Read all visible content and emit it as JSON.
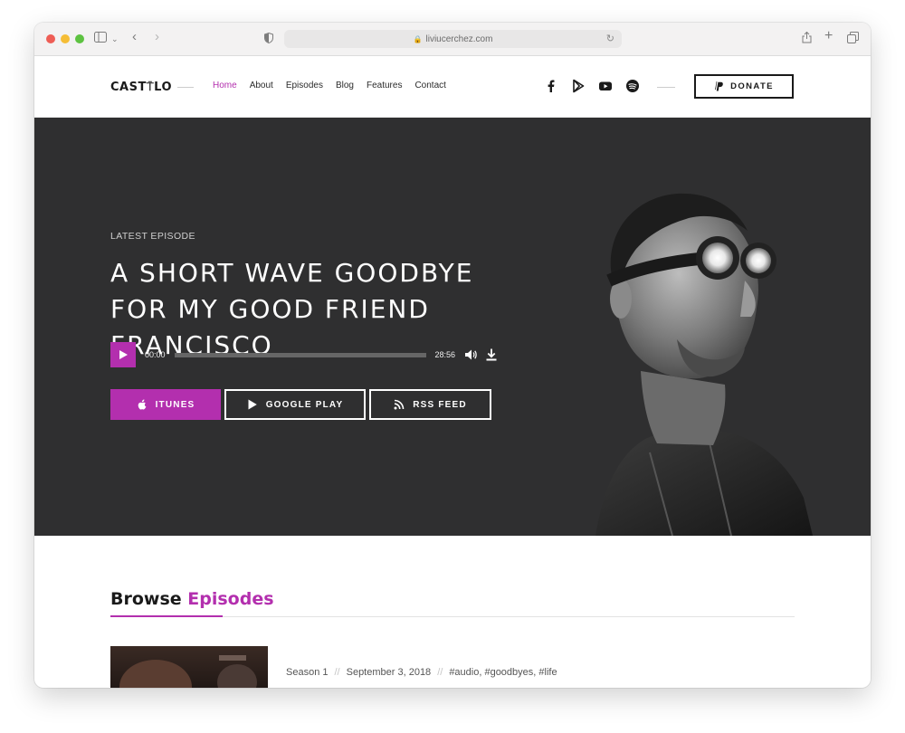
{
  "browser": {
    "url": "liviucerchez.com",
    "traffic_colors": [
      "#ee5d55",
      "#f5bd36",
      "#5dc241"
    ]
  },
  "header": {
    "logo": "CAST⍑LO",
    "nav": [
      "Home",
      "About",
      "Episodes",
      "Blog",
      "Features",
      "Contact"
    ],
    "active_nav": "Home",
    "social_icons": [
      "facebook-icon",
      "google-play-icon",
      "youtube-icon",
      "spotify-icon"
    ],
    "donate_label": "DONATE"
  },
  "hero": {
    "kicker": "LATEST EPISODE",
    "title": "A SHORT WAVE GOODBYE FOR MY GOOD FRIEND FRANCISCO",
    "player": {
      "current_time": "00:00",
      "duration": "28:56",
      "progress": 0
    },
    "buttons": {
      "itunes": "ITUNES",
      "google_play": "GOOGLE PLAY",
      "rss": "RSS FEED"
    }
  },
  "browse": {
    "title_plain": "Browse",
    "title_accent": "Episodes",
    "episode": {
      "season": "Season 1",
      "date": "September 3, 2018",
      "tags": "#audio, #goodbyes, #life",
      "separator": "//"
    }
  },
  "colors": {
    "accent": "#b32fae",
    "hero_bg": "#2f2f30"
  }
}
